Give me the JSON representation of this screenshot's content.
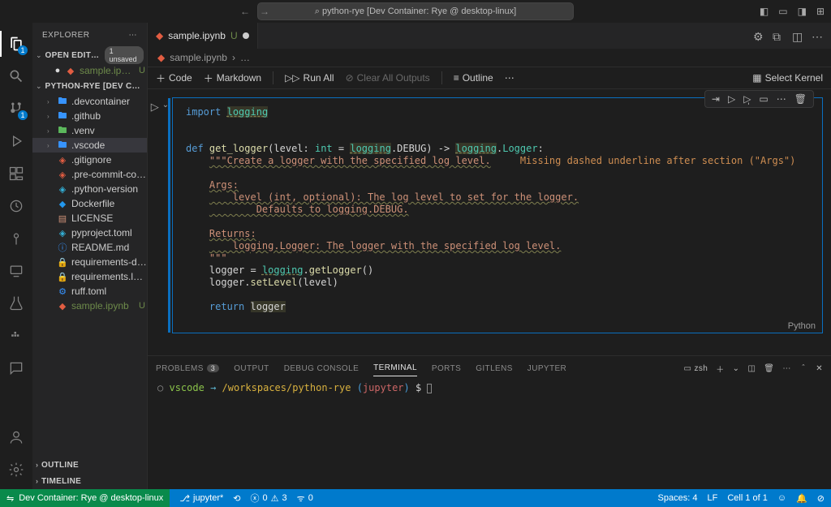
{
  "titlebar": {
    "search": "python-rye [Dev Container: Rye @ desktop-linux]"
  },
  "sidebar": {
    "title": "EXPLORER",
    "openEditorsLabel": "OPEN EDITORS",
    "unsavedPill": "1 unsaved",
    "openEditors": [
      {
        "label": "sample.ipy…",
        "status": "U"
      }
    ],
    "workspaceLabel": "PYTHON-RYE [DEV CON…",
    "tree": [
      {
        "type": "folder",
        "label": ".devcontainer",
        "iconClass": "ic-folder"
      },
      {
        "type": "folder",
        "label": ".github",
        "iconClass": "ic-folder"
      },
      {
        "type": "folder",
        "label": ".venv",
        "iconClass": "ic-folder-green"
      },
      {
        "type": "folder",
        "label": ".vscode",
        "iconClass": "ic-folder",
        "selected": true
      },
      {
        "type": "file",
        "label": ".gitignore",
        "iconClass": "ic-git"
      },
      {
        "type": "file",
        "label": ".pre-commit-con…",
        "iconClass": "ic-git"
      },
      {
        "type": "file",
        "label": ".python-version",
        "iconClass": "ic-toml"
      },
      {
        "type": "file",
        "label": "Dockerfile",
        "iconClass": "ic-docker"
      },
      {
        "type": "file",
        "label": "LICENSE",
        "iconClass": "ic-license"
      },
      {
        "type": "file",
        "label": "pyproject.toml",
        "iconClass": "ic-toml"
      },
      {
        "type": "file",
        "label": "README.md",
        "iconClass": "ic-readme"
      },
      {
        "type": "file",
        "label": "requirements-de…",
        "iconClass": "ic-lock"
      },
      {
        "type": "file",
        "label": "requirements.lock",
        "iconClass": "ic-lock"
      },
      {
        "type": "file",
        "label": "ruff.toml",
        "iconClass": "ic-ruff"
      },
      {
        "type": "file",
        "label": "sample.ipynb",
        "iconClass": "ic-jup",
        "git": "U"
      }
    ],
    "outlineLabel": "OUTLINE",
    "timelineLabel": "TIMELINE"
  },
  "activity": {
    "explorerBadge": "1",
    "scmBadge": "1"
  },
  "tab": {
    "label": "sample.ipynb",
    "status": "U"
  },
  "breadcrumb": {
    "file": "sample.ipynb",
    "sep": "…"
  },
  "notebookToolbar": {
    "code": "Code",
    "markdown": "Markdown",
    "runAll": "Run All",
    "clearAll": "Clear All Outputs",
    "outline": "Outline",
    "selectKernel": "Select Kernel"
  },
  "code": {
    "l1a": "import",
    "l1b": "logging",
    "l3a": "def",
    "l3b": "get_logger",
    "l3c": "level",
    "l3d": "int",
    "l3e": "logging",
    "l3f": "DEBUG",
    "l3g": "logging",
    "l3h": "Logger",
    "l4": "\"\"\"Create a logger with the specified log level.",
    "l4hint": "Missing dashed underline after section (\"Args\")",
    "l6": "Args:",
    "l7": "    level (int, optional): The log level to set for the logger.",
    "l8": "        Defaults to logging.DEBUG.",
    "l10": "Returns:",
    "l11": "    logging.Logger: The logger with the specified log level.",
    "l12": "\"\"\"",
    "l13a": "logger",
    "l13b": "logging",
    "l13c": "getLogger",
    "l14a": "logger",
    "l14b": "setLevel",
    "l14c": "level",
    "l16a": "return",
    "l16b": "logger",
    "lang": "Python"
  },
  "panel": {
    "problems": "PROBLEMS",
    "problemsCount": "3",
    "output": "OUTPUT",
    "debug": "DEBUG CONSOLE",
    "terminal": "TERMINAL",
    "ports": "PORTS",
    "gitlens": "GITLENS",
    "jupyter": "JUPYTER",
    "shell": "zsh"
  },
  "terminal": {
    "user": "vscode",
    "path": "/workspaces/python-rye",
    "ctx": "jupyter",
    "prompt": "$"
  },
  "statusbar": {
    "remote": "Dev Container: Rye @ desktop-linux",
    "jupyter": "jupyter*",
    "sync": "",
    "errors": "0",
    "warnings": "3",
    "ports": "0",
    "spaces": "Spaces: 4",
    "eol": "LF",
    "cell": "Cell 1 of 1"
  }
}
